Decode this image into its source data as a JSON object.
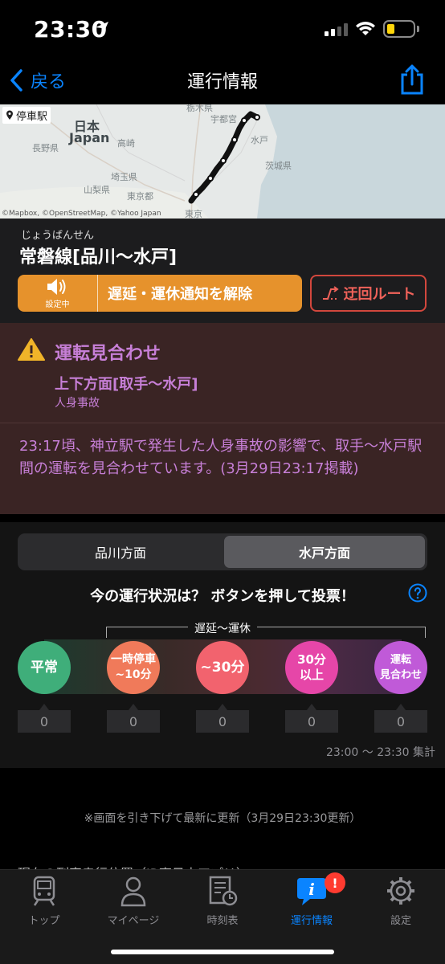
{
  "status": {
    "time": "23:30"
  },
  "nav": {
    "back_label": "戻る",
    "title": "運行情報"
  },
  "map": {
    "stop_label": "停車駅",
    "credit": "©Mapbox, ©OpenStreetMap, ©Yahoo Japan",
    "places": [
      "日本",
      "Japan",
      "長野県",
      "山梨県",
      "埼玉県",
      "東京都",
      "茨城県",
      "宇都宮",
      "高崎",
      "水戸",
      "栃木県",
      "東京"
    ]
  },
  "line": {
    "furigana": "じょうばんせん",
    "name": "常磐線[品川〜水戸]",
    "notify_sub": "設定中",
    "notify_label": "遅延・運休通知を解除",
    "detour_label": "迂回ルート"
  },
  "alert": {
    "title": "運転見合わせ",
    "direction": "上下方面[取手〜水戸]",
    "cause": "人身事故",
    "body": "23:17頃、神立駅で発生した人身事故の影響で、取手〜水戸駅間の運転を見合わせています。(3月29日23:17掲載)"
  },
  "vote": {
    "tabs": [
      "品川方面",
      "水戸方面"
    ],
    "selected_tab": "水戸方面",
    "question": "今の運行状況は？ ボタンを押して投票！",
    "bracket_label": "遅延〜運休",
    "options": [
      {
        "label1": "平常",
        "label2": "",
        "count": "0",
        "color": "#3fae7a"
      },
      {
        "label1": "一時停車",
        "label2": "~10分",
        "count": "0",
        "color": "#f07a5a"
      },
      {
        "label1": "~30分",
        "label2": "",
        "count": "0",
        "color": "#f2636e"
      },
      {
        "label1": "30分",
        "label2": "以上",
        "count": "0",
        "color": "#e646a8"
      },
      {
        "label1": "運転",
        "label2": "見合わせ",
        "count": "0",
        "color": "#c05ad8"
      }
    ],
    "tally": "23:00 〜 23:30 集計"
  },
  "refresh_note": "※画面を引き下げて最新に更新（3月29日23:30更新）",
  "peek_text": "現在の列車走行位置（JR東日本アプリ）",
  "tabbar": {
    "items": [
      "トップ",
      "マイページ",
      "時刻表",
      "運行情報",
      "設定"
    ],
    "active": "運行情報",
    "badge": "!"
  },
  "colors": {
    "accent": "#0a84ff",
    "alert": "#c77fd7",
    "orange": "#e6922c",
    "red": "#d2473d"
  }
}
